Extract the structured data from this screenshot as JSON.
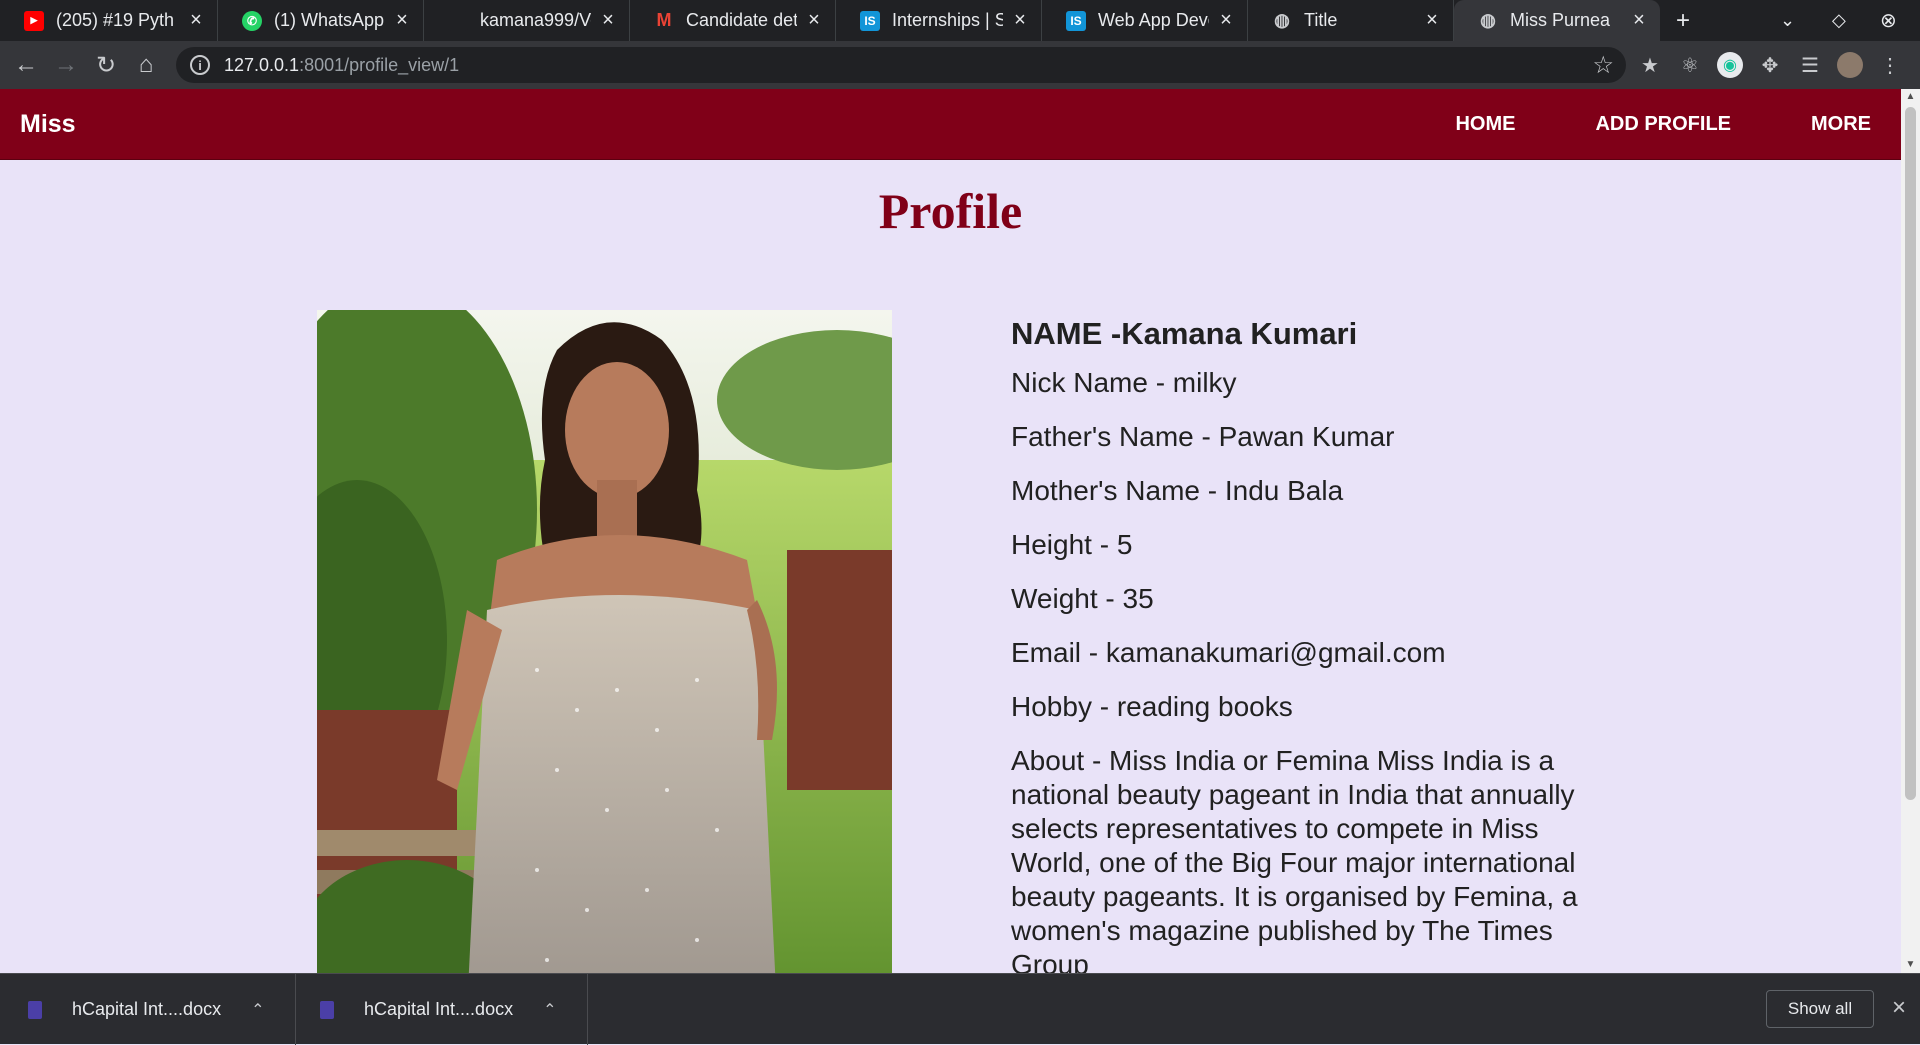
{
  "browser": {
    "tabs": [
      {
        "title": "(205) #19 Pyth",
        "icon": "youtube-icon",
        "color": "#ff0000"
      },
      {
        "title": "(1) WhatsApp",
        "icon": "whatsapp-icon",
        "color": "#25d366"
      },
      {
        "title": "kamana999/Vo",
        "icon": "github-icon",
        "color": "#202124"
      },
      {
        "title": "Candidate deta",
        "icon": "gmail-icon",
        "color": "#ea4335"
      },
      {
        "title": "Internships | Su",
        "icon": "internshala-icon",
        "color": "#1295d8"
      },
      {
        "title": "Web App Devel",
        "icon": "internshala-icon",
        "color": "#1295d8"
      },
      {
        "title": "Title",
        "icon": "globe-icon",
        "color": "#c9cbce"
      },
      {
        "title": "Miss Purnea",
        "icon": "globe-icon",
        "color": "#c9cbce"
      }
    ],
    "url_host": "127.0.0.1",
    "url_path": ":8001/profile_view/1"
  },
  "navbar": {
    "brand": "Miss",
    "links": [
      "HOME",
      "ADD PROFILE",
      "MORE"
    ],
    "bg_color": "#800018"
  },
  "profile": {
    "heading": "Profile",
    "name": "NAME -Kamana Kumari",
    "nick_name": "Nick Name - milky",
    "father_name": "Father's Name - Pawan Kumar",
    "mother_name": "Mother's Name - Indu Bala",
    "height": "Height - 5",
    "weight": "Weight - 35",
    "email": "Email - kamanakumari@gmail.com",
    "hobby": "Hobby - reading books",
    "about": "About - Miss India or Femina Miss India is a national beauty pageant in India that annually selects representatives to compete in Miss World, one of the Big Four major international beauty pageants. It is organised by Femina, a women's magazine published by The Times Group"
  },
  "downloads": {
    "items": [
      "hCapital Int....docx",
      "hCapital Int....docx"
    ],
    "show_all": "Show all"
  }
}
